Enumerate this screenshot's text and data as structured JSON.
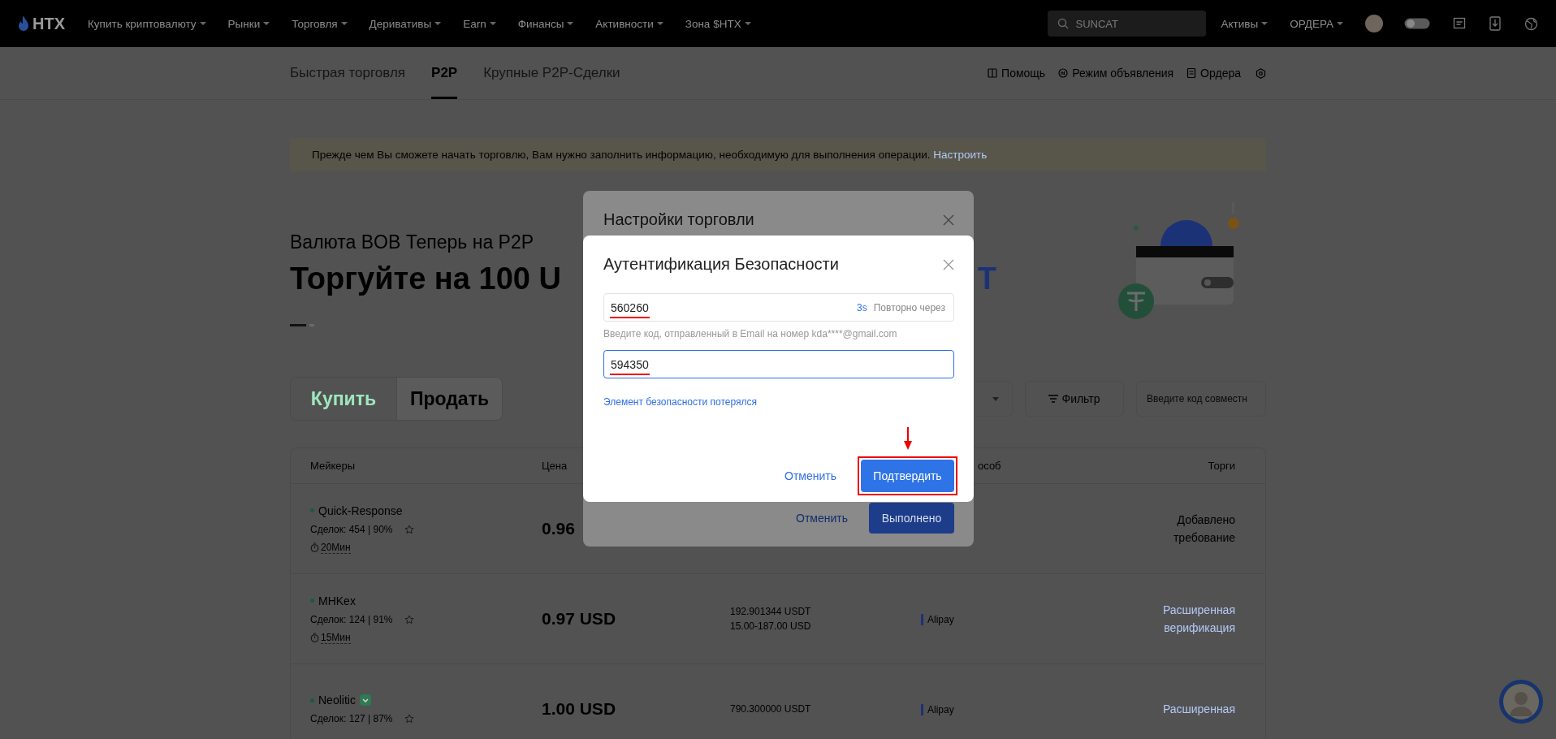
{
  "nav": {
    "logo": "HTX",
    "items": [
      "Купить криптовалюту",
      "Рынки",
      "Торговля",
      "Деривативы",
      "Earn",
      "Финансы",
      "Активности",
      "Зона $HTX"
    ],
    "search": {
      "placeholder": "SUNCAT"
    },
    "menus": [
      "Активы",
      "ОРДЕРА"
    ]
  },
  "subnav": {
    "tabs": [
      {
        "label": "Быстрая торговля",
        "selected": false
      },
      {
        "label": "P2P",
        "selected": true
      },
      {
        "label": "Крупные P2P-Сделки",
        "selected": false
      }
    ],
    "links": [
      {
        "label": "Помощь",
        "kind": "help"
      },
      {
        "label": "Режим объявления",
        "kind": "ads"
      },
      {
        "label": "Ордера",
        "kind": "orders"
      }
    ]
  },
  "notice": {
    "text": "Прежде чем Вы сможете начать торговлю, Вам нужно заполнить информацию, необходимую для выполнения операции.",
    "link": "Настроить"
  },
  "hero": {
    "subtitle": "Валюта BOB Теперь на P2P",
    "title_start": "Торгуйте на 100 U",
    "title_end": "T",
    "slides": [
      {
        "selected": true
      },
      {
        "selected": false
      }
    ]
  },
  "side_tabs": [
    {
      "label": "Купить",
      "selected": true
    },
    {
      "label": "Продать",
      "selected": false
    }
  ],
  "toolbar": {
    "filter": "Фильтр",
    "code_placeholder": "Введите код совместн"
  },
  "table": {
    "columns": [
      "Мейкеры",
      "Цена",
      "особ",
      "Торги"
    ],
    "rows": [
      {
        "maker": "Quick-Response",
        "verified": false,
        "deals": "Сделок: 454 | 90%",
        "time": "20Мин",
        "price": "0.96",
        "action": "Добавлено требование",
        "kind": "note"
      },
      {
        "maker": "MHKex",
        "verified": false,
        "deals": "Сделок: 124 | 91%",
        "time": "15Мин",
        "price": "0.97 USD",
        "amount": "192.901344 USDT",
        "limits": "15.00-187.00 USD",
        "payment": "Alipay",
        "action": "Расширенная верификация",
        "kind": "link"
      },
      {
        "maker": "Neolitic",
        "verified": true,
        "deals": "Сделок: 127 | 87%",
        "price": "1.00 USD",
        "amount": "790.300000 USDT",
        "payment": "Alipay",
        "action": "Расширенная",
        "kind": "link"
      }
    ]
  },
  "back_dialog": {
    "title": "Настройки торговли",
    "cancel": "Отменить",
    "confirm": "Выполнено"
  },
  "dialog": {
    "title": "Аутентификация Безопасности",
    "fields": [
      {
        "value": "560260",
        "focused": false,
        "marked": true,
        "countdown": "3s",
        "resend": "Повторно через",
        "hint": "Введите код, отправленный в Email на номер kda****@gmail.com"
      },
      {
        "value": "594350",
        "focused": true,
        "marked": true
      }
    ],
    "lost_link": "Элемент безопасности потерялся",
    "cancel": "Отменить",
    "confirm": "Подтвердить",
    "confirm_highlighted": true
  }
}
